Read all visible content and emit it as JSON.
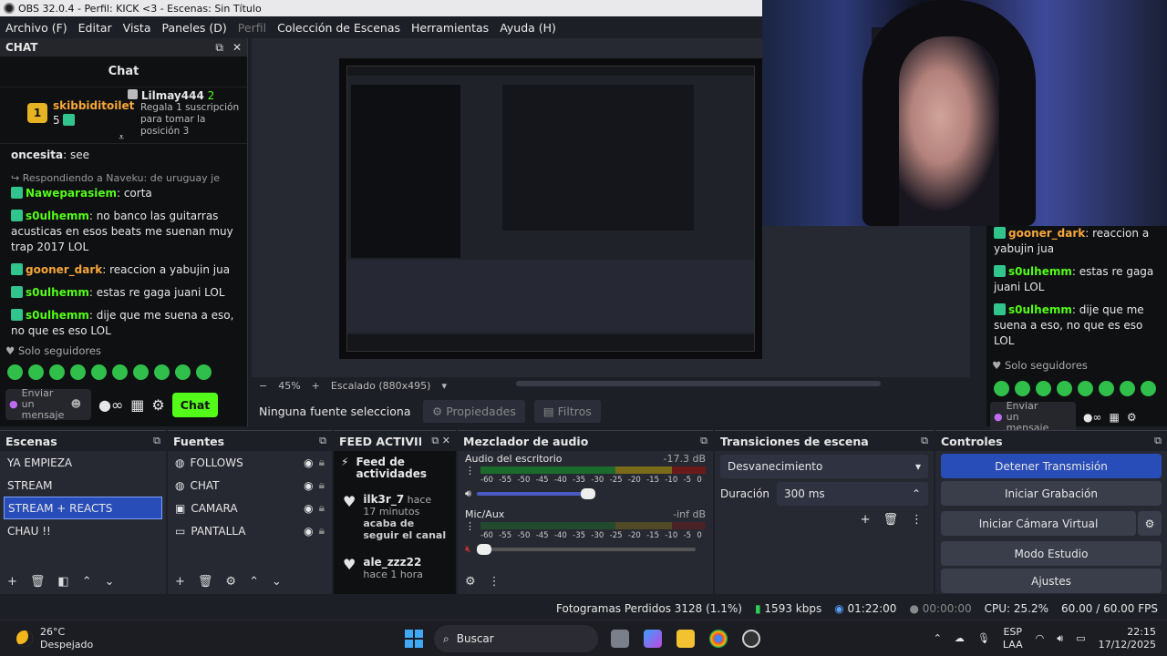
{
  "window": {
    "title": "OBS 32.0.4 - Perfil: KICK <3 - Escenas: Sin Título"
  },
  "menu": [
    "Archivo (F)",
    "Editar",
    "Vista",
    "Paneles (D)",
    "Perfil",
    "Colección de Escenas",
    "Herramientas",
    "Ayuda (H)"
  ],
  "chat": {
    "dock_title": "CHAT",
    "title": "Chat",
    "top_user1": "skibbiditoilet",
    "top_user1_count": "5",
    "top_user2": "Lilmay444",
    "top_user2_count": "2",
    "top_user2_note": "Regala 1 suscripción para tomar la posición 3",
    "messages": [
      {
        "user": "oncesita",
        "text": ": see",
        "color": "plain"
      },
      {
        "reply": "Respondiendo a Naveku: de uruguay je",
        "user": "Naweparasiem",
        "text": ": corta",
        "color": "green"
      },
      {
        "user": "s0ulhemm",
        "text": ": no banco las guitarras acusticas en esos beats me suenan muy trap 2017 LOL",
        "color": "green"
      },
      {
        "user": "gooner_dark",
        "text": ": reaccion a yabujin jua",
        "color": "orange"
      },
      {
        "user": "s0ulhemm",
        "text": ": estas re gaga juani LOL",
        "color": "green"
      },
      {
        "user": "s0ulhemm",
        "text": ": dije que me suena a eso, no que es eso LOL",
        "color": "green"
      }
    ],
    "followers_only": "Solo seguidores",
    "send_placeholder": "Enviar un mensaje",
    "chat_button": "Chat"
  },
  "chat_right": {
    "messages": [
      {
        "user": "gooner_dark",
        "text": ": reaccion a yabujin jua",
        "color": "orange"
      },
      {
        "user": "s0ulhemm",
        "text": ": estas re gaga juani LOL",
        "color": "green"
      },
      {
        "user": "s0ulhemm",
        "text": ": dije que me suena a eso, no que es eso LOL",
        "color": "green"
      }
    ],
    "followers_only": "Solo seguidores",
    "send_placeholder": "Enviar un mensaje"
  },
  "preview": {
    "zoom": "45%",
    "scaling": "Escalado (880x495)",
    "no_source": "Ninguna fuente selecciona",
    "properties": "Propiedades",
    "filters": "Filtros"
  },
  "scenes": {
    "title": "Escenas",
    "items": [
      "YA EMPIEZA",
      "STREAM",
      "STREAM + REACTS",
      "CHAU !!"
    ],
    "selected_index": 2
  },
  "sources": {
    "title": "Fuentes",
    "items": [
      {
        "name": "FOLLOWS",
        "icon": "globe-icon"
      },
      {
        "name": "CHAT",
        "icon": "globe-icon"
      },
      {
        "name": "CAMARA",
        "icon": "camera-icon"
      },
      {
        "name": "PANTALLA",
        "icon": "monitor-icon"
      }
    ]
  },
  "feed": {
    "title": "FEED ACTIVID...",
    "header": "Feed de actividades",
    "items": [
      {
        "user": "ilk3r_7",
        "time": "hace 17 minutos",
        "action": "acaba de seguir el canal"
      },
      {
        "user": "ale_zzz22",
        "time": "hace 1 hora",
        "action": ""
      }
    ]
  },
  "mixer": {
    "title": "Mezclador de audio",
    "channels": [
      {
        "name": "Audio del escritorio",
        "level": "-17.3 dB"
      },
      {
        "name": "Mic/Aux",
        "level": "-inf dB"
      }
    ],
    "ticks": [
      "-60",
      "-55",
      "-50",
      "-45",
      "-40",
      "-35",
      "-30",
      "-25",
      "-20",
      "-15",
      "-10",
      "-5",
      "0"
    ]
  },
  "transitions": {
    "title": "Transiciones de escena",
    "selected": "Desvanecimiento",
    "duration_label": "Duración",
    "duration_value": "300 ms"
  },
  "controls": {
    "title": "Controles",
    "buttons": [
      "Detener Transmisión",
      "Iniciar Grabación",
      "Iniciar Cámara Virtual",
      "Modo Estudio",
      "Ajustes"
    ]
  },
  "status": {
    "dropped": "Fotogramas Perdidos 3128 (1.1%)",
    "bitrate": "1593 kbps",
    "stream_time": "01:22:00",
    "rec_time": "00:00:00",
    "cpu": "CPU: 25.2%",
    "fps": "60.00 / 60.00 FPS"
  },
  "taskbar": {
    "temp": "26°C",
    "weather": "Despejado",
    "search": "Buscar",
    "lang1": "ESP",
    "lang2": "LAA",
    "time": "22:15",
    "date": "17/12/2025"
  },
  "colors": {
    "kick_green": "#53fc18",
    "obs_blue": "#284cb8",
    "orange_user": "#f6a63a"
  }
}
